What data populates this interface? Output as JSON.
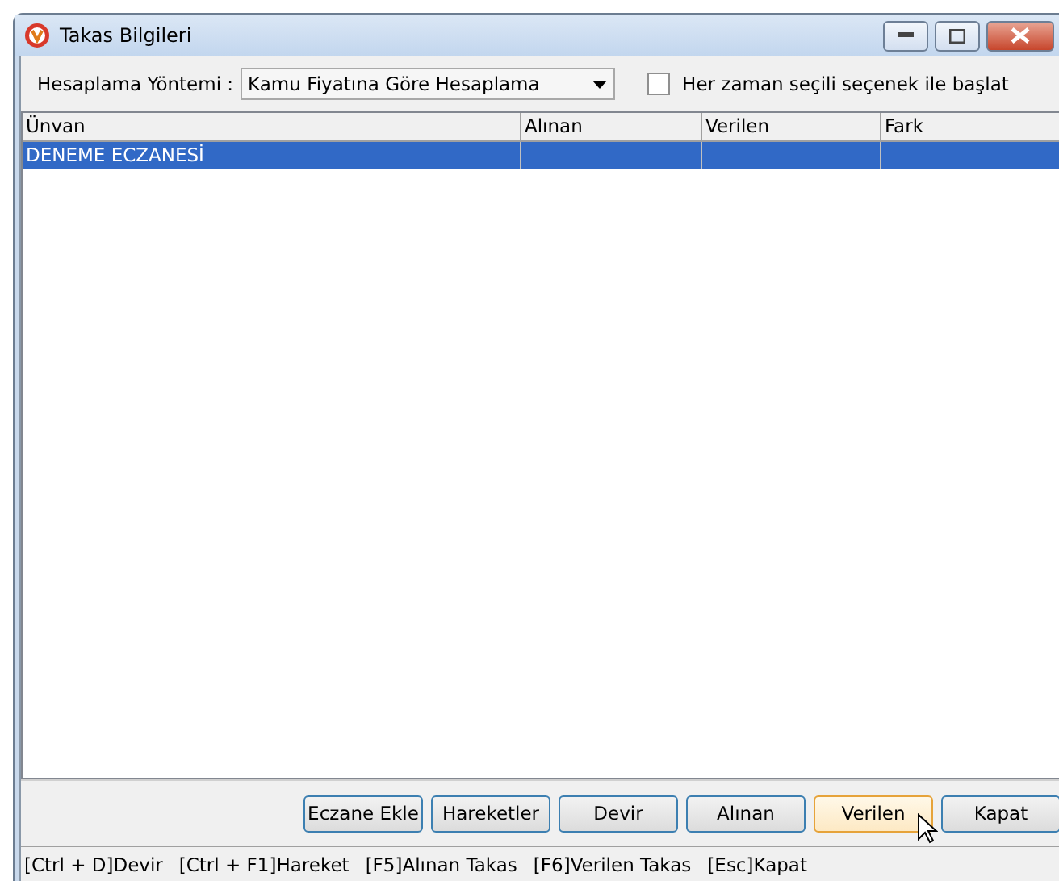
{
  "window": {
    "title": "Takas Bilgileri"
  },
  "calculation": {
    "label": "Hesaplama Yöntemi :",
    "value": "Kamu Fiyatına Göre Hesaplama"
  },
  "always_start": {
    "label": "Her zaman seçili seçenek ile başlat",
    "checked": false
  },
  "table": {
    "columns": [
      "Ünvan",
      "Alınan",
      "Verilen",
      "Fark"
    ],
    "rows": [
      {
        "cells": [
          "DENEME ECZANESİ",
          "",
          "",
          ""
        ],
        "selected": true
      }
    ]
  },
  "buttons": [
    {
      "label": "Eczane Ekle",
      "hovered": false
    },
    {
      "label": "Hareketler",
      "hovered": false
    },
    {
      "label": "Devir",
      "hovered": false
    },
    {
      "label": "Alınan",
      "hovered": false
    },
    {
      "label": "Verilen",
      "hovered": true
    },
    {
      "label": "Kapat",
      "hovered": false
    }
  ],
  "status_bar": [
    "[Ctrl + D]Devir",
    "[Ctrl + F1]Hareket",
    "[F5]Alınan Takas",
    "[F6]Verilen Takas",
    "[Esc]Kapat"
  ]
}
